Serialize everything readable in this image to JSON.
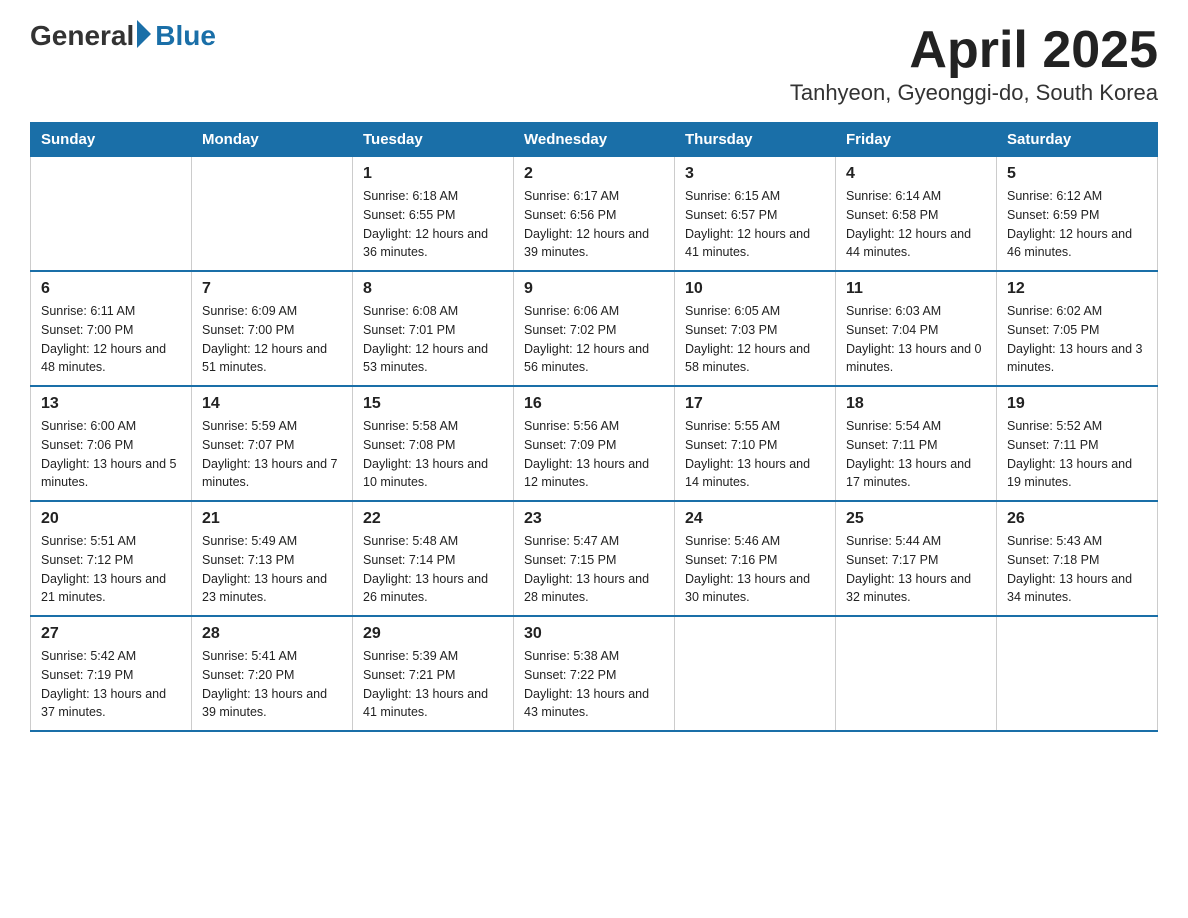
{
  "header": {
    "logo_general": "General",
    "logo_blue": "Blue",
    "title": "April 2025",
    "subtitle": "Tanhyeon, Gyeonggi-do, South Korea"
  },
  "calendar": {
    "days_of_week": [
      "Sunday",
      "Monday",
      "Tuesday",
      "Wednesday",
      "Thursday",
      "Friday",
      "Saturday"
    ],
    "weeks": [
      [
        {
          "day": "",
          "sunrise": "",
          "sunset": "",
          "daylight": ""
        },
        {
          "day": "",
          "sunrise": "",
          "sunset": "",
          "daylight": ""
        },
        {
          "day": "1",
          "sunrise": "Sunrise: 6:18 AM",
          "sunset": "Sunset: 6:55 PM",
          "daylight": "Daylight: 12 hours and 36 minutes."
        },
        {
          "day": "2",
          "sunrise": "Sunrise: 6:17 AM",
          "sunset": "Sunset: 6:56 PM",
          "daylight": "Daylight: 12 hours and 39 minutes."
        },
        {
          "day": "3",
          "sunrise": "Sunrise: 6:15 AM",
          "sunset": "Sunset: 6:57 PM",
          "daylight": "Daylight: 12 hours and 41 minutes."
        },
        {
          "day": "4",
          "sunrise": "Sunrise: 6:14 AM",
          "sunset": "Sunset: 6:58 PM",
          "daylight": "Daylight: 12 hours and 44 minutes."
        },
        {
          "day": "5",
          "sunrise": "Sunrise: 6:12 AM",
          "sunset": "Sunset: 6:59 PM",
          "daylight": "Daylight: 12 hours and 46 minutes."
        }
      ],
      [
        {
          "day": "6",
          "sunrise": "Sunrise: 6:11 AM",
          "sunset": "Sunset: 7:00 PM",
          "daylight": "Daylight: 12 hours and 48 minutes."
        },
        {
          "day": "7",
          "sunrise": "Sunrise: 6:09 AM",
          "sunset": "Sunset: 7:00 PM",
          "daylight": "Daylight: 12 hours and 51 minutes."
        },
        {
          "day": "8",
          "sunrise": "Sunrise: 6:08 AM",
          "sunset": "Sunset: 7:01 PM",
          "daylight": "Daylight: 12 hours and 53 minutes."
        },
        {
          "day": "9",
          "sunrise": "Sunrise: 6:06 AM",
          "sunset": "Sunset: 7:02 PM",
          "daylight": "Daylight: 12 hours and 56 minutes."
        },
        {
          "day": "10",
          "sunrise": "Sunrise: 6:05 AM",
          "sunset": "Sunset: 7:03 PM",
          "daylight": "Daylight: 12 hours and 58 minutes."
        },
        {
          "day": "11",
          "sunrise": "Sunrise: 6:03 AM",
          "sunset": "Sunset: 7:04 PM",
          "daylight": "Daylight: 13 hours and 0 minutes."
        },
        {
          "day": "12",
          "sunrise": "Sunrise: 6:02 AM",
          "sunset": "Sunset: 7:05 PM",
          "daylight": "Daylight: 13 hours and 3 minutes."
        }
      ],
      [
        {
          "day": "13",
          "sunrise": "Sunrise: 6:00 AM",
          "sunset": "Sunset: 7:06 PM",
          "daylight": "Daylight: 13 hours and 5 minutes."
        },
        {
          "day": "14",
          "sunrise": "Sunrise: 5:59 AM",
          "sunset": "Sunset: 7:07 PM",
          "daylight": "Daylight: 13 hours and 7 minutes."
        },
        {
          "day": "15",
          "sunrise": "Sunrise: 5:58 AM",
          "sunset": "Sunset: 7:08 PM",
          "daylight": "Daylight: 13 hours and 10 minutes."
        },
        {
          "day": "16",
          "sunrise": "Sunrise: 5:56 AM",
          "sunset": "Sunset: 7:09 PM",
          "daylight": "Daylight: 13 hours and 12 minutes."
        },
        {
          "day": "17",
          "sunrise": "Sunrise: 5:55 AM",
          "sunset": "Sunset: 7:10 PM",
          "daylight": "Daylight: 13 hours and 14 minutes."
        },
        {
          "day": "18",
          "sunrise": "Sunrise: 5:54 AM",
          "sunset": "Sunset: 7:11 PM",
          "daylight": "Daylight: 13 hours and 17 minutes."
        },
        {
          "day": "19",
          "sunrise": "Sunrise: 5:52 AM",
          "sunset": "Sunset: 7:11 PM",
          "daylight": "Daylight: 13 hours and 19 minutes."
        }
      ],
      [
        {
          "day": "20",
          "sunrise": "Sunrise: 5:51 AM",
          "sunset": "Sunset: 7:12 PM",
          "daylight": "Daylight: 13 hours and 21 minutes."
        },
        {
          "day": "21",
          "sunrise": "Sunrise: 5:49 AM",
          "sunset": "Sunset: 7:13 PM",
          "daylight": "Daylight: 13 hours and 23 minutes."
        },
        {
          "day": "22",
          "sunrise": "Sunrise: 5:48 AM",
          "sunset": "Sunset: 7:14 PM",
          "daylight": "Daylight: 13 hours and 26 minutes."
        },
        {
          "day": "23",
          "sunrise": "Sunrise: 5:47 AM",
          "sunset": "Sunset: 7:15 PM",
          "daylight": "Daylight: 13 hours and 28 minutes."
        },
        {
          "day": "24",
          "sunrise": "Sunrise: 5:46 AM",
          "sunset": "Sunset: 7:16 PM",
          "daylight": "Daylight: 13 hours and 30 minutes."
        },
        {
          "day": "25",
          "sunrise": "Sunrise: 5:44 AM",
          "sunset": "Sunset: 7:17 PM",
          "daylight": "Daylight: 13 hours and 32 minutes."
        },
        {
          "day": "26",
          "sunrise": "Sunrise: 5:43 AM",
          "sunset": "Sunset: 7:18 PM",
          "daylight": "Daylight: 13 hours and 34 minutes."
        }
      ],
      [
        {
          "day": "27",
          "sunrise": "Sunrise: 5:42 AM",
          "sunset": "Sunset: 7:19 PM",
          "daylight": "Daylight: 13 hours and 37 minutes."
        },
        {
          "day": "28",
          "sunrise": "Sunrise: 5:41 AM",
          "sunset": "Sunset: 7:20 PM",
          "daylight": "Daylight: 13 hours and 39 minutes."
        },
        {
          "day": "29",
          "sunrise": "Sunrise: 5:39 AM",
          "sunset": "Sunset: 7:21 PM",
          "daylight": "Daylight: 13 hours and 41 minutes."
        },
        {
          "day": "30",
          "sunrise": "Sunrise: 5:38 AM",
          "sunset": "Sunset: 7:22 PM",
          "daylight": "Daylight: 13 hours and 43 minutes."
        },
        {
          "day": "",
          "sunrise": "",
          "sunset": "",
          "daylight": ""
        },
        {
          "day": "",
          "sunrise": "",
          "sunset": "",
          "daylight": ""
        },
        {
          "day": "",
          "sunrise": "",
          "sunset": "",
          "daylight": ""
        }
      ]
    ]
  }
}
